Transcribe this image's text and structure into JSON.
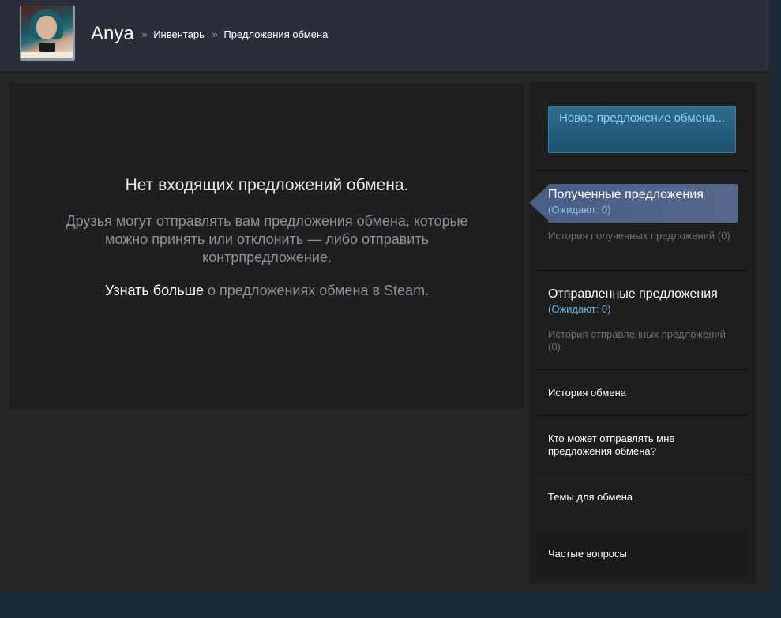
{
  "header": {
    "username": "Anya",
    "separator": "»",
    "breadcrumbs": [
      "Инвентарь",
      "Предложения обмена"
    ]
  },
  "main": {
    "empty_title": "Нет входящих предложений обмена.",
    "empty_description": "Друзья могут отправлять вам предложения обмена, которые можно принять или отклонить — либо отправить контрпредложение.",
    "learn_more_link": "Узнать больше",
    "learn_more_rest": " о предложениях обмена в Steam."
  },
  "sidebar": {
    "new_offer_button": "Новое предложение обмена...",
    "received": {
      "title": "Полученные предложения",
      "pending": "(Ожидают: 0)",
      "history": "История полученных предложений (0)"
    },
    "sent": {
      "title": "Отправленные предложения",
      "pending": "(Ожидают: 0)",
      "history": "История отправленных предложений (0)"
    },
    "trade_history": "История обмена",
    "who_can_send": "Кто может отправлять мне предложения обмена?",
    "trade_topics": "Темы для обмена",
    "faq": "Частые вопросы"
  },
  "colors": {
    "accent_button": "#2e6d8c",
    "active_item": "#4a5f85",
    "pending_text": "#66b7e6"
  }
}
